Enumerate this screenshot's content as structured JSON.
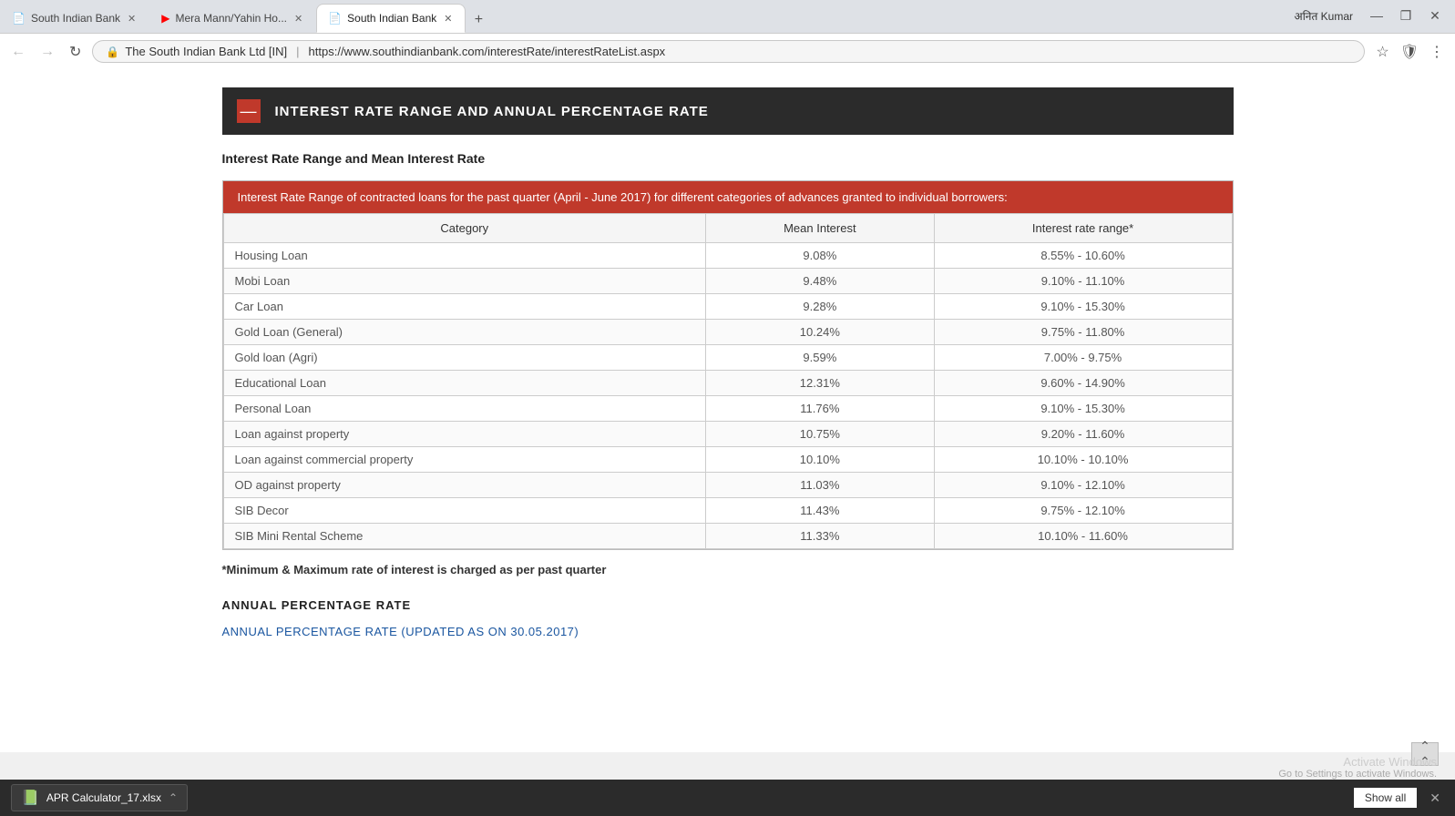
{
  "browser": {
    "tabs": [
      {
        "id": "tab1",
        "label": "South Indian Bank",
        "icon": "page-icon",
        "active": false,
        "youtube": false
      },
      {
        "id": "tab2",
        "label": "Mera Mann/Yahin Ho...",
        "icon": "youtube-icon",
        "active": false,
        "youtube": true
      },
      {
        "id": "tab3",
        "label": "South Indian Bank",
        "icon": "page-icon",
        "active": true,
        "youtube": false
      }
    ],
    "address": {
      "secure_label": "🔒",
      "site_name": "The South Indian Bank Ltd [IN]",
      "url": "https://www.southindianbank.com/interestRate/interestRateList.aspx"
    },
    "user": "अनित Kumar",
    "window_controls": {
      "minimize": "—",
      "maximize": "❐",
      "close": "✕"
    }
  },
  "page": {
    "section_header": {
      "minus_label": "—",
      "title": "INTEREST RATE RANGE AND ANNUAL PERCENTAGE RATE"
    },
    "subsection_title": "Interest Rate Range and Mean Interest Rate",
    "info_banner": "Interest Rate Range of contracted loans for the past quarter (April - June 2017) for different categories of advances granted to individual borrowers:",
    "table": {
      "headers": [
        "Category",
        "Mean Interest",
        "Interest rate range*"
      ],
      "rows": [
        [
          "Housing Loan",
          "9.08%",
          "8.55% - 10.60%"
        ],
        [
          "Mobi Loan",
          "9.48%",
          "9.10% - 11.10%"
        ],
        [
          "Car Loan",
          "9.28%",
          "9.10% - 15.30%"
        ],
        [
          "Gold Loan (General)",
          "10.24%",
          "9.75% - 11.80%"
        ],
        [
          "Gold loan (Agri)",
          "9.59%",
          "7.00% - 9.75%"
        ],
        [
          "Educational Loan",
          "12.31%",
          "9.60% - 14.90%"
        ],
        [
          "Personal Loan",
          "11.76%",
          "9.10% - 15.30%"
        ],
        [
          "Loan against property",
          "10.75%",
          "9.20% - 11.60%"
        ],
        [
          "Loan against commercial property",
          "10.10%",
          "10.10% - 10.10%"
        ],
        [
          "OD against property",
          "11.03%",
          "9.10% - 12.10%"
        ],
        [
          "SIB Decor",
          "11.43%",
          "9.75% - 12.10%"
        ],
        [
          "SIB Mini Rental Scheme",
          "11.33%",
          "10.10% - 11.60%"
        ]
      ]
    },
    "footnote": "*Minimum & Maximum rate of interest is charged as per past quarter",
    "annual_heading": "ANNUAL PERCENTAGE RATE",
    "apr_link_label": "ANNUAL PERCENTAGE RATE (UPDATED AS ON 30.05.2017)"
  },
  "bottom_bar": {
    "download_filename": "APR Calculator_17.xlsx",
    "show_all_label": "Show all",
    "close_label": "✕"
  },
  "activate_windows": {
    "title": "Activate Windows",
    "subtitle": "Go to Settings to activate Windows."
  }
}
